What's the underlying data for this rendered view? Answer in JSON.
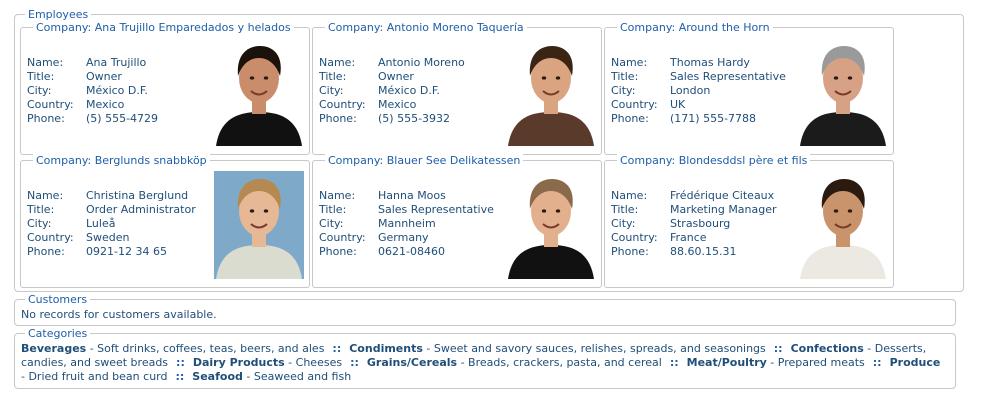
{
  "employees": {
    "legend": "Employees",
    "field_labels": {
      "name": "Name:",
      "title": "Title:",
      "city": "City:",
      "country": "Country:",
      "phone": "Phone:"
    },
    "cards": [
      {
        "company": "Company: Ana Trujillo Emparedados y helados",
        "name": "Ana Trujillo",
        "title": "Owner",
        "city": "México D.F.",
        "country": "Mexico",
        "phone": "(5) 555-4729",
        "photo": {
          "skin": "#c98d6b",
          "hair": "#1c120c",
          "cloth": "#111111",
          "bg": "#ffffff"
        }
      },
      {
        "company": "Company: Antonio Moreno Taquería",
        "name": "Antonio Moreno",
        "title": "Owner",
        "city": "México D.F.",
        "country": "Mexico",
        "phone": "(5) 555-3932",
        "photo": {
          "skin": "#d9a47f",
          "hair": "#3a2414",
          "cloth": "#5a3a2a",
          "bg": "#ffffff"
        }
      },
      {
        "company": "Company: Around the Horn",
        "name": "Thomas Hardy",
        "title": "Sales Representative",
        "city": "London",
        "country": "UK",
        "phone": "(171) 555-7788",
        "photo": {
          "skin": "#d6a184",
          "hair": "#9a9a9a",
          "cloth": "#1b1b1b",
          "bg": "#ffffff"
        }
      },
      {
        "company": "Company: Berglunds snabbköp",
        "name": "Christina Berglund",
        "title": "Order Administrator",
        "city": "Luleå",
        "country": "Sweden",
        "phone": "0921-12 34 65",
        "photo": {
          "skin": "#e6b896",
          "hair": "#b48a52",
          "cloth": "#d9dccf",
          "bg": "#7fa9c9"
        }
      },
      {
        "company": "Company: Blauer See Delikatessen",
        "name": "Hanna Moos",
        "title": "Sales Representative",
        "city": "Mannheim",
        "country": "Germany",
        "phone": "0621-08460",
        "photo": {
          "skin": "#e3b08e",
          "hair": "#8a6a4a",
          "cloth": "#111111",
          "bg": "#ffffff"
        }
      },
      {
        "company": "Company: Blondesddsl père et fils",
        "name": "Frédérique Citeaux",
        "title": "Marketing Manager",
        "city": "Strasbourg",
        "country": "France",
        "phone": "88.60.15.31",
        "photo": {
          "skin": "#c9946c",
          "hair": "#2a1a10",
          "cloth": "#ece9e2",
          "bg": "#ffffff"
        }
      }
    ]
  },
  "customers": {
    "legend": "Customers",
    "empty_message": "No records for customers available."
  },
  "categories": {
    "legend": "Categories",
    "separator": "::",
    "items": [
      {
        "name": "Beverages",
        "desc": " - Soft drinks, coffees, teas, beers, and ales"
      },
      {
        "name": "Condiments",
        "desc": " - Sweet and savory sauces, relishes, spreads, and seasonings"
      },
      {
        "name": "Confections",
        "desc": " - Desserts, candies, and sweet breads"
      },
      {
        "name": "Dairy Products",
        "desc": " - Cheeses"
      },
      {
        "name": "Grains/Cereals",
        "desc": " - Breads, crackers, pasta, and cereal"
      },
      {
        "name": "Meat/Poultry",
        "desc": " - Prepared meats"
      },
      {
        "name": "Produce",
        "desc": " - Dried fruit and bean curd"
      },
      {
        "name": "Seafood",
        "desc": " - Seaweed and fish"
      }
    ]
  }
}
